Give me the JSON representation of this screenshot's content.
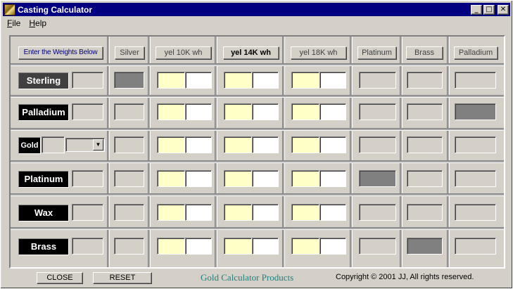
{
  "window": {
    "title": "Casting Calculator",
    "controls": {
      "minimize": "_",
      "maximize": "□",
      "close": "✕"
    }
  },
  "menu": [
    {
      "label": "File",
      "underline": "F",
      "rest": "ile"
    },
    {
      "label": "Help",
      "underline": "H",
      "rest": "elp"
    }
  ],
  "headers": {
    "instruction": "Enter the Weights Below",
    "columns": [
      "Silver",
      "yel 10K wh",
      "yel 14K wh",
      "yel 18K wh",
      "Platinum",
      "Brass",
      "Palladium"
    ]
  },
  "rows": [
    {
      "label": "Sterling"
    },
    {
      "label": "Palladium"
    },
    {
      "label": "Gold",
      "has_combo": true
    },
    {
      "label": "Platinum"
    },
    {
      "label": "Wax"
    },
    {
      "label": "Brass"
    }
  ],
  "buttons": {
    "close": "CLOSE",
    "reset": "RESET"
  },
  "footer": {
    "brand": "Gold Calculator Products",
    "copyright": "Copyright © 2001 JJ, All rights reserved."
  },
  "colors": {
    "titlebar": "#000080",
    "window_bg": "#d4d0c8",
    "input_yellow": "#ffffc8",
    "input_white": "#ffffff",
    "disabled_dark": "#808080",
    "brand_text": "#208080"
  }
}
